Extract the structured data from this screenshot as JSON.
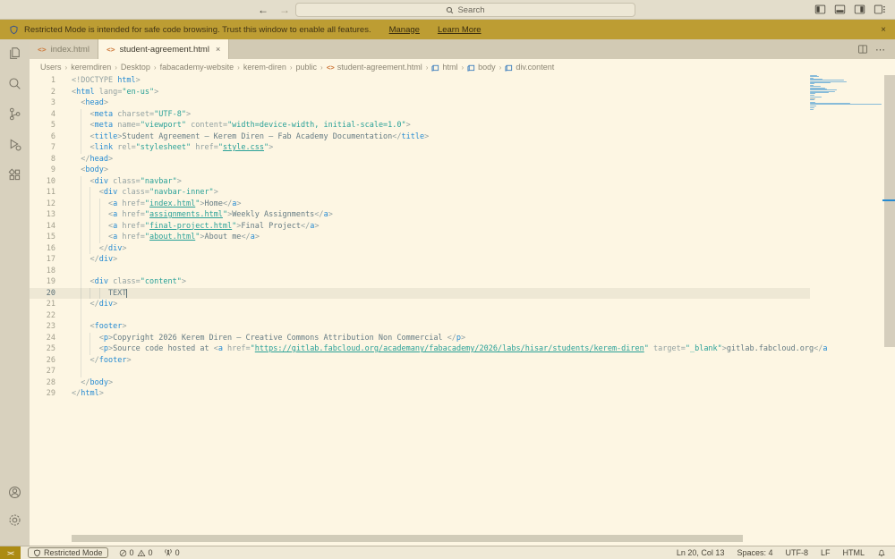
{
  "titlebar": {
    "search_placeholder": "Search",
    "back": "←",
    "forward": "→"
  },
  "banner": {
    "text": "Restricted Mode is intended for safe code browsing. Trust this window to enable all features.",
    "manage_label": "Manage",
    "learn_more_label": "Learn More",
    "close": "×"
  },
  "tabs": [
    {
      "label": "index.html",
      "active": false
    },
    {
      "label": "student-agreement.html",
      "active": true
    }
  ],
  "breadcrumb": {
    "path": [
      "Users",
      "keremdiren",
      "Desktop",
      "fabacademy-website",
      "kerem-diren",
      "public"
    ],
    "file": "student-agreement.html",
    "symbols": [
      "html",
      "body",
      "div.content"
    ]
  },
  "editor": {
    "current_line": 20,
    "cursor_col": 13,
    "lines": [
      {
        "n": 1,
        "g": 0,
        "seg": [
          [
            "p",
            "<!DOCTYPE "
          ],
          [
            "t",
            "html"
          ],
          [
            "p",
            ">"
          ]
        ]
      },
      {
        "n": 2,
        "g": 0,
        "seg": [
          [
            "p",
            "<"
          ],
          [
            "t",
            "html"
          ],
          [
            "a",
            " lang="
          ],
          [
            "s",
            "\"en-us\""
          ],
          [
            "p",
            ">"
          ]
        ]
      },
      {
        "n": 3,
        "g": 0,
        "seg": [
          [
            "x",
            "  "
          ],
          [
            "p",
            "<"
          ],
          [
            "t",
            "head"
          ],
          [
            "p",
            ">"
          ]
        ]
      },
      {
        "n": 4,
        "g": 1,
        "seg": [
          [
            "x",
            "    "
          ],
          [
            "p",
            "<"
          ],
          [
            "t",
            "meta"
          ],
          [
            "a",
            " charset="
          ],
          [
            "s",
            "\"UTF-8\""
          ],
          [
            "p",
            ">"
          ]
        ]
      },
      {
        "n": 5,
        "g": 1,
        "seg": [
          [
            "x",
            "    "
          ],
          [
            "p",
            "<"
          ],
          [
            "t",
            "meta"
          ],
          [
            "a",
            " name="
          ],
          [
            "s",
            "\"viewport\""
          ],
          [
            "a",
            " content="
          ],
          [
            "s",
            "\"width=device-width, initial-scale=1.0\""
          ],
          [
            "p",
            ">"
          ]
        ]
      },
      {
        "n": 6,
        "g": 1,
        "seg": [
          [
            "x",
            "    "
          ],
          [
            "p",
            "<"
          ],
          [
            "t",
            "title"
          ],
          [
            "p",
            ">"
          ],
          [
            "x",
            "Student Agreement – Kerem Diren – Fab Academy Documentation"
          ],
          [
            "p",
            "</"
          ],
          [
            "t",
            "title"
          ],
          [
            "p",
            ">"
          ]
        ]
      },
      {
        "n": 7,
        "g": 1,
        "seg": [
          [
            "x",
            "    "
          ],
          [
            "p",
            "<"
          ],
          [
            "t",
            "link"
          ],
          [
            "a",
            " rel="
          ],
          [
            "s",
            "\"stylesheet\""
          ],
          [
            "a",
            " href="
          ],
          [
            "s",
            "\""
          ],
          [
            "u",
            "style.css"
          ],
          [
            "s",
            "\""
          ],
          [
            "p",
            ">"
          ]
        ]
      },
      {
        "n": 8,
        "g": 0,
        "seg": [
          [
            "x",
            "  "
          ],
          [
            "p",
            "</"
          ],
          [
            "t",
            "head"
          ],
          [
            "p",
            ">"
          ]
        ]
      },
      {
        "n": 9,
        "g": 0,
        "seg": [
          [
            "x",
            "  "
          ],
          [
            "p",
            "<"
          ],
          [
            "t",
            "body"
          ],
          [
            "p",
            ">"
          ]
        ]
      },
      {
        "n": 10,
        "g": 1,
        "seg": [
          [
            "x",
            "    "
          ],
          [
            "p",
            "<"
          ],
          [
            "t",
            "div"
          ],
          [
            "a",
            " class="
          ],
          [
            "s",
            "\"navbar\""
          ],
          [
            "p",
            ">"
          ]
        ]
      },
      {
        "n": 11,
        "g": 2,
        "seg": [
          [
            "x",
            "      "
          ],
          [
            "p",
            "<"
          ],
          [
            "t",
            "div"
          ],
          [
            "a",
            " class="
          ],
          [
            "s",
            "\"navbar-inner\""
          ],
          [
            "p",
            ">"
          ]
        ]
      },
      {
        "n": 12,
        "g": 3,
        "seg": [
          [
            "x",
            "        "
          ],
          [
            "p",
            "<"
          ],
          [
            "t",
            "a"
          ],
          [
            "a",
            " href="
          ],
          [
            "s",
            "\""
          ],
          [
            "u",
            "index.html"
          ],
          [
            "s",
            "\""
          ],
          [
            "p",
            ">"
          ],
          [
            "x",
            "Home"
          ],
          [
            "p",
            "</"
          ],
          [
            "t",
            "a"
          ],
          [
            "p",
            ">"
          ]
        ]
      },
      {
        "n": 13,
        "g": 3,
        "seg": [
          [
            "x",
            "        "
          ],
          [
            "p",
            "<"
          ],
          [
            "t",
            "a"
          ],
          [
            "a",
            " href="
          ],
          [
            "s",
            "\""
          ],
          [
            "u",
            "assignments.html"
          ],
          [
            "s",
            "\""
          ],
          [
            "p",
            ">"
          ],
          [
            "x",
            "Weekly Assignments"
          ],
          [
            "p",
            "</"
          ],
          [
            "t",
            "a"
          ],
          [
            "p",
            ">"
          ]
        ]
      },
      {
        "n": 14,
        "g": 3,
        "seg": [
          [
            "x",
            "        "
          ],
          [
            "p",
            "<"
          ],
          [
            "t",
            "a"
          ],
          [
            "a",
            " href="
          ],
          [
            "s",
            "\""
          ],
          [
            "u",
            "final-project.html"
          ],
          [
            "s",
            "\""
          ],
          [
            "p",
            ">"
          ],
          [
            "x",
            "Final Project"
          ],
          [
            "p",
            "</"
          ],
          [
            "t",
            "a"
          ],
          [
            "p",
            ">"
          ]
        ]
      },
      {
        "n": 15,
        "g": 3,
        "seg": [
          [
            "x",
            "        "
          ],
          [
            "p",
            "<"
          ],
          [
            "t",
            "a"
          ],
          [
            "a",
            " href="
          ],
          [
            "s",
            "\""
          ],
          [
            "u",
            "about.html"
          ],
          [
            "s",
            "\""
          ],
          [
            "p",
            ">"
          ],
          [
            "x",
            "About me"
          ],
          [
            "p",
            "</"
          ],
          [
            "t",
            "a"
          ],
          [
            "p",
            ">"
          ]
        ]
      },
      {
        "n": 16,
        "g": 2,
        "seg": [
          [
            "x",
            "      "
          ],
          [
            "p",
            "</"
          ],
          [
            "t",
            "div"
          ],
          [
            "p",
            ">"
          ]
        ]
      },
      {
        "n": 17,
        "g": 1,
        "seg": [
          [
            "x",
            "    "
          ],
          [
            "p",
            "</"
          ],
          [
            "t",
            "div"
          ],
          [
            "p",
            ">"
          ]
        ]
      },
      {
        "n": 18,
        "g": 1,
        "seg": []
      },
      {
        "n": 19,
        "g": 1,
        "seg": [
          [
            "x",
            "    "
          ],
          [
            "p",
            "<"
          ],
          [
            "t",
            "div"
          ],
          [
            "a",
            " class="
          ],
          [
            "s",
            "\"content\""
          ],
          [
            "p",
            ">"
          ]
        ]
      },
      {
        "n": 20,
        "g": 3,
        "seg": [
          [
            "x",
            "        TEXT"
          ]
        ]
      },
      {
        "n": 21,
        "g": 1,
        "seg": [
          [
            "x",
            "    "
          ],
          [
            "p",
            "</"
          ],
          [
            "t",
            "div"
          ],
          [
            "p",
            ">"
          ]
        ]
      },
      {
        "n": 22,
        "g": 1,
        "seg": []
      },
      {
        "n": 23,
        "g": 1,
        "seg": [
          [
            "x",
            "    "
          ],
          [
            "p",
            "<"
          ],
          [
            "t",
            "footer"
          ],
          [
            "p",
            ">"
          ]
        ]
      },
      {
        "n": 24,
        "g": 2,
        "seg": [
          [
            "x",
            "      "
          ],
          [
            "p",
            "<"
          ],
          [
            "t",
            "p"
          ],
          [
            "p",
            ">"
          ],
          [
            "x",
            "Copyright 2026 Kerem Diren – Creative Commons Attribution Non Commercial "
          ],
          [
            "p",
            "</"
          ],
          [
            "t",
            "p"
          ],
          [
            "p",
            ">"
          ]
        ]
      },
      {
        "n": 25,
        "g": 2,
        "seg": [
          [
            "x",
            "      "
          ],
          [
            "p",
            "<"
          ],
          [
            "t",
            "p"
          ],
          [
            "p",
            ">"
          ],
          [
            "x",
            "Source code hosted at "
          ],
          [
            "p",
            "<"
          ],
          [
            "t",
            "a"
          ],
          [
            "a",
            " href="
          ],
          [
            "s",
            "\""
          ],
          [
            "u",
            "https://gitlab.fabcloud.org/academany/fabacademy/2026/labs/hisar/students/kerem-diren"
          ],
          [
            "s",
            "\""
          ],
          [
            "a",
            " target="
          ],
          [
            "s",
            "\"_blank\""
          ],
          [
            "p",
            ">"
          ],
          [
            "x",
            "gitlab.fabcloud.org"
          ],
          [
            "p",
            "</"
          ],
          [
            "t",
            "a"
          ]
        ]
      },
      {
        "n": 26,
        "g": 1,
        "seg": [
          [
            "x",
            "    "
          ],
          [
            "p",
            "</"
          ],
          [
            "t",
            "footer"
          ],
          [
            "p",
            ">"
          ]
        ]
      },
      {
        "n": 27,
        "g": 1,
        "seg": []
      },
      {
        "n": 28,
        "g": 0,
        "seg": [
          [
            "x",
            "  "
          ],
          [
            "p",
            "</"
          ],
          [
            "t",
            "body"
          ],
          [
            "p",
            ">"
          ]
        ]
      },
      {
        "n": 29,
        "g": 0,
        "seg": [
          [
            "p",
            "</"
          ],
          [
            "t",
            "html"
          ],
          [
            "p",
            ">"
          ]
        ]
      }
    ]
  },
  "statusbar": {
    "remote_glyph": "><",
    "restricted_label": "Restricted Mode",
    "errors": "0",
    "warnings": "0",
    "ports": "0",
    "line_col": "Ln 20, Col 13",
    "spaces": "Spaces: 4",
    "encoding": "UTF-8",
    "eol": "LF",
    "language": "HTML"
  },
  "colors": {
    "editor_bg": "#FDF6E3",
    "banner_gold": "#BD9D33",
    "tag_blue": "#268BD2",
    "string_teal": "#2AA198",
    "punctuation_gray": "#93A1A1",
    "text_base": "#657B83",
    "file_icon_orange": "#CE7A3C",
    "line_highlight": "#EEE8D5",
    "remote_gold": "#AC8B13"
  }
}
